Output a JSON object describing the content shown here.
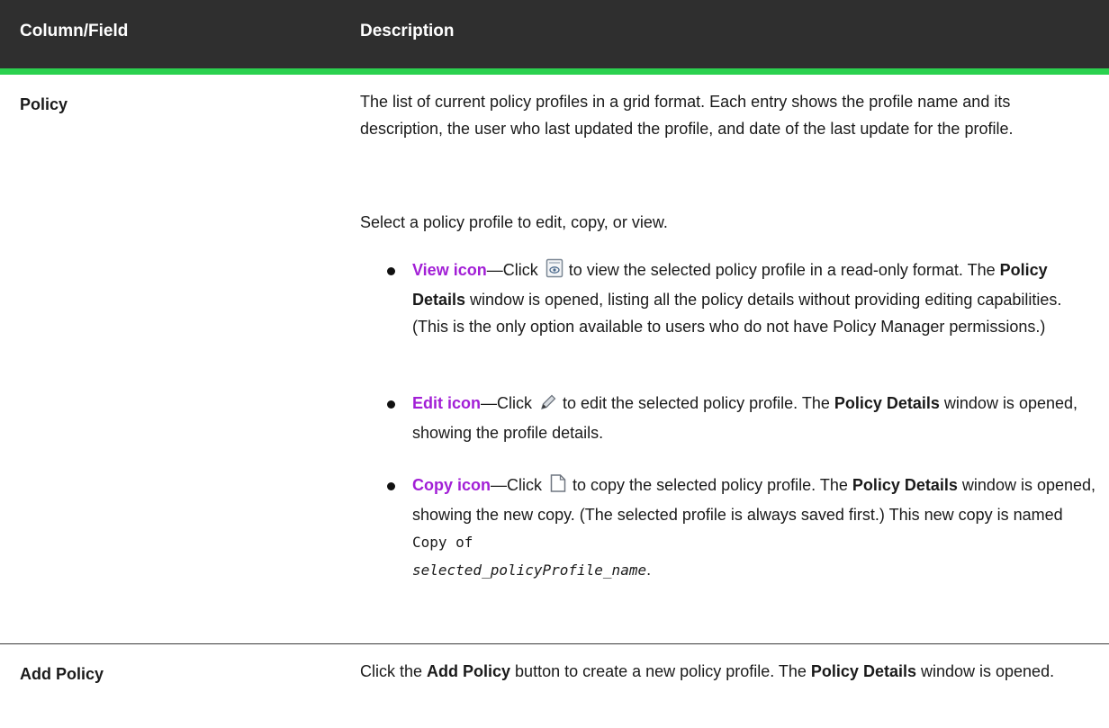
{
  "header": {
    "col1": "Column/Field",
    "col2": "Description"
  },
  "rows": [
    {
      "label": "Policy",
      "para1": "The list of current policy profiles in a grid format. Each entry shows the profile name and its description, the user who last updated the profile, and date of the last update for the profile.",
      "para2": "Select a policy profile to edit, copy, or view.",
      "bullets": [
        {
          "link": "View icon",
          "icon": "view-document-icon",
          "pre": "—Click",
          "text_a": "to view the selected policy profile in a read-only format. The ",
          "bold": "Policy Details",
          "text_b": " window is opened, listing all the policy details without providing editing capabilities. (This is the only option available to users who do not have Policy Manager permissions.)"
        },
        {
          "link": "Edit icon",
          "icon": "pencil-icon",
          "pre": "—Click",
          "text_a": "to edit the selected policy profile. The ",
          "bold": "Policy Details",
          "text_b": " window is opened, showing the profile details."
        },
        {
          "link": "Copy icon",
          "icon": "copy-page-icon",
          "pre": "—Click",
          "text_a": "to copy the selected policy profile. The ",
          "bold": "Policy Details",
          "text_b": " window is opened, showing the new copy. (The selected profile is always saved first.) This new copy is named ",
          "code": "Copy of",
          "code_italic": "selected_policyProfile_name",
          "end": "."
        }
      ]
    },
    {
      "label": "Add Policy",
      "text_a": "Click the ",
      "bold_a": "Add Policy",
      "text_b": " button to create a new policy profile. The ",
      "bold_b": "Policy Details",
      "text_c": " window is opened."
    }
  ],
  "colors": {
    "header_bg": "#2f2f2f",
    "header_accent": "#2bd14f",
    "link": "#a21fd6"
  }
}
